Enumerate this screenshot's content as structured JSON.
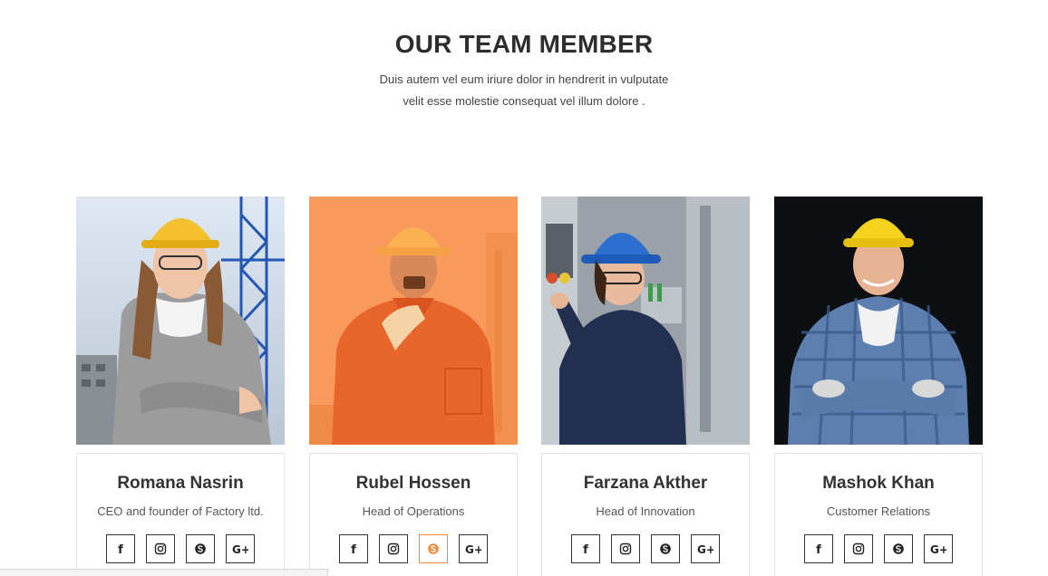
{
  "section": {
    "title": "OUR TEAM MEMBER",
    "subtitle_line1": "Duis autem vel eum iriure dolor in hendrerit in vulputate",
    "subtitle_line2": "velit esse molestie consequat vel illum dolore ."
  },
  "colors": {
    "accent": "#f08a3c",
    "text": "#333333"
  },
  "team": [
    {
      "name": "Romana Nasrin",
      "role": "CEO and founder of Factory ltd.",
      "hat": "yellow-hard-hat"
    },
    {
      "name": "Rubel Hossen",
      "role": "Head of Operations",
      "hat": "yellow-hard-hat",
      "overlay": "orange"
    },
    {
      "name": "Farzana Akther",
      "role": "Head of Innovation",
      "hat": "blue-hard-hat"
    },
    {
      "name": "Mashok Khan",
      "role": "Customer Relations",
      "hat": "yellow-hard-hat"
    }
  ],
  "social_icons": [
    "facebook-icon",
    "instagram-icon",
    "skype-icon",
    "google-plus-icon"
  ],
  "social_glyphs": {
    "facebook": "f",
    "google": "G+"
  }
}
